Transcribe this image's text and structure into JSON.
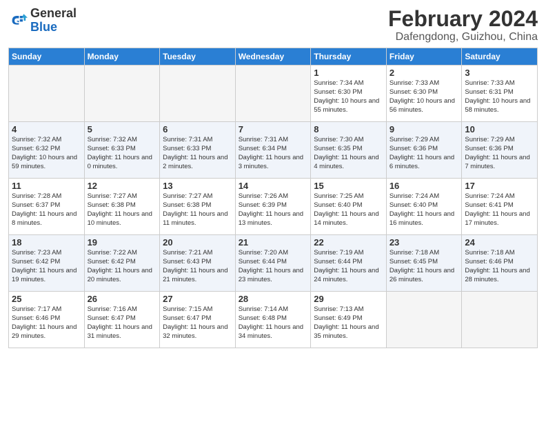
{
  "header": {
    "logo_general": "General",
    "logo_blue": "Blue",
    "month_year": "February 2024",
    "location": "Dafengdong, Guizhou, China"
  },
  "days_of_week": [
    "Sunday",
    "Monday",
    "Tuesday",
    "Wednesday",
    "Thursday",
    "Friday",
    "Saturday"
  ],
  "weeks": [
    [
      {
        "day": "",
        "info": ""
      },
      {
        "day": "",
        "info": ""
      },
      {
        "day": "",
        "info": ""
      },
      {
        "day": "",
        "info": ""
      },
      {
        "day": "1",
        "info": "Sunrise: 7:34 AM\nSunset: 6:30 PM\nDaylight: 10 hours and 55 minutes."
      },
      {
        "day": "2",
        "info": "Sunrise: 7:33 AM\nSunset: 6:30 PM\nDaylight: 10 hours and 56 minutes."
      },
      {
        "day": "3",
        "info": "Sunrise: 7:33 AM\nSunset: 6:31 PM\nDaylight: 10 hours and 58 minutes."
      }
    ],
    [
      {
        "day": "4",
        "info": "Sunrise: 7:32 AM\nSunset: 6:32 PM\nDaylight: 10 hours and 59 minutes."
      },
      {
        "day": "5",
        "info": "Sunrise: 7:32 AM\nSunset: 6:33 PM\nDaylight: 11 hours and 0 minutes."
      },
      {
        "day": "6",
        "info": "Sunrise: 7:31 AM\nSunset: 6:33 PM\nDaylight: 11 hours and 2 minutes."
      },
      {
        "day": "7",
        "info": "Sunrise: 7:31 AM\nSunset: 6:34 PM\nDaylight: 11 hours and 3 minutes."
      },
      {
        "day": "8",
        "info": "Sunrise: 7:30 AM\nSunset: 6:35 PM\nDaylight: 11 hours and 4 minutes."
      },
      {
        "day": "9",
        "info": "Sunrise: 7:29 AM\nSunset: 6:36 PM\nDaylight: 11 hours and 6 minutes."
      },
      {
        "day": "10",
        "info": "Sunrise: 7:29 AM\nSunset: 6:36 PM\nDaylight: 11 hours and 7 minutes."
      }
    ],
    [
      {
        "day": "11",
        "info": "Sunrise: 7:28 AM\nSunset: 6:37 PM\nDaylight: 11 hours and 8 minutes."
      },
      {
        "day": "12",
        "info": "Sunrise: 7:27 AM\nSunset: 6:38 PM\nDaylight: 11 hours and 10 minutes."
      },
      {
        "day": "13",
        "info": "Sunrise: 7:27 AM\nSunset: 6:38 PM\nDaylight: 11 hours and 11 minutes."
      },
      {
        "day": "14",
        "info": "Sunrise: 7:26 AM\nSunset: 6:39 PM\nDaylight: 11 hours and 13 minutes."
      },
      {
        "day": "15",
        "info": "Sunrise: 7:25 AM\nSunset: 6:40 PM\nDaylight: 11 hours and 14 minutes."
      },
      {
        "day": "16",
        "info": "Sunrise: 7:24 AM\nSunset: 6:40 PM\nDaylight: 11 hours and 16 minutes."
      },
      {
        "day": "17",
        "info": "Sunrise: 7:24 AM\nSunset: 6:41 PM\nDaylight: 11 hours and 17 minutes."
      }
    ],
    [
      {
        "day": "18",
        "info": "Sunrise: 7:23 AM\nSunset: 6:42 PM\nDaylight: 11 hours and 19 minutes."
      },
      {
        "day": "19",
        "info": "Sunrise: 7:22 AM\nSunset: 6:42 PM\nDaylight: 11 hours and 20 minutes."
      },
      {
        "day": "20",
        "info": "Sunrise: 7:21 AM\nSunset: 6:43 PM\nDaylight: 11 hours and 21 minutes."
      },
      {
        "day": "21",
        "info": "Sunrise: 7:20 AM\nSunset: 6:44 PM\nDaylight: 11 hours and 23 minutes."
      },
      {
        "day": "22",
        "info": "Sunrise: 7:19 AM\nSunset: 6:44 PM\nDaylight: 11 hours and 24 minutes."
      },
      {
        "day": "23",
        "info": "Sunrise: 7:18 AM\nSunset: 6:45 PM\nDaylight: 11 hours and 26 minutes."
      },
      {
        "day": "24",
        "info": "Sunrise: 7:18 AM\nSunset: 6:46 PM\nDaylight: 11 hours and 28 minutes."
      }
    ],
    [
      {
        "day": "25",
        "info": "Sunrise: 7:17 AM\nSunset: 6:46 PM\nDaylight: 11 hours and 29 minutes."
      },
      {
        "day": "26",
        "info": "Sunrise: 7:16 AM\nSunset: 6:47 PM\nDaylight: 11 hours and 31 minutes."
      },
      {
        "day": "27",
        "info": "Sunrise: 7:15 AM\nSunset: 6:47 PM\nDaylight: 11 hours and 32 minutes."
      },
      {
        "day": "28",
        "info": "Sunrise: 7:14 AM\nSunset: 6:48 PM\nDaylight: 11 hours and 34 minutes."
      },
      {
        "day": "29",
        "info": "Sunrise: 7:13 AM\nSunset: 6:49 PM\nDaylight: 11 hours and 35 minutes."
      },
      {
        "day": "",
        "info": ""
      },
      {
        "day": "",
        "info": ""
      }
    ]
  ]
}
